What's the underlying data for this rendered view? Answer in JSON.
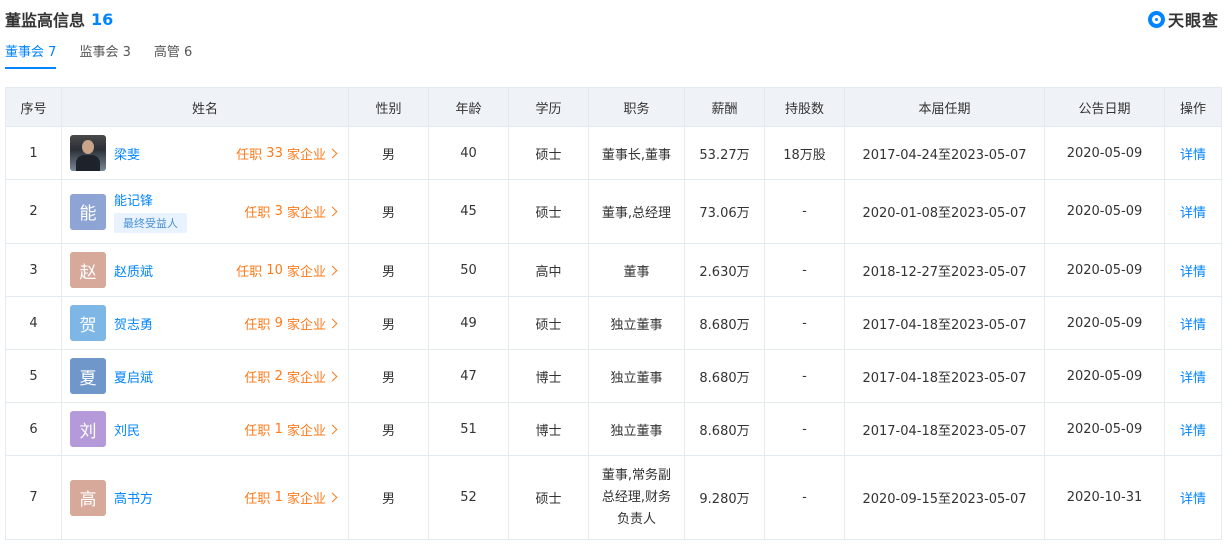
{
  "header": {
    "title": "董监高信息",
    "count": "16",
    "logo_text": "天眼查"
  },
  "tabs": [
    {
      "label": "董事会",
      "count": "7"
    },
    {
      "label": "监事会",
      "count": "3"
    },
    {
      "label": "高管",
      "count": "6"
    }
  ],
  "table": {
    "columns": [
      "序号",
      "姓名",
      "性别",
      "年龄",
      "学历",
      "职务",
      "薪酬",
      "持股数",
      "本届任期",
      "公告日期",
      "操作"
    ],
    "rows": [
      {
        "no": "1",
        "avatar": "",
        "name": "梁斐",
        "job_prefix": "任职",
        "job_count": "33",
        "job_suffix": "家企业",
        "badge": "",
        "gender": "男",
        "age": "40",
        "edu": "硕士",
        "title": "董事长,董事",
        "salary": "53.27万",
        "shares": "18万股",
        "term": "2017-04-24至2023-05-07",
        "date": "2020-05-09",
        "action": "详情",
        "color": ""
      },
      {
        "no": "2",
        "avatar": "能",
        "name": "能记锋",
        "job_prefix": "任职",
        "job_count": "3",
        "job_suffix": "家企业",
        "badge": "最终受益人",
        "gender": "男",
        "age": "45",
        "edu": "硕士",
        "title": "董事,总经理",
        "salary": "73.06万",
        "shares": "-",
        "term": "2020-01-08至2023-05-07",
        "date": "2020-05-09",
        "action": "详情",
        "color": "#8da4d4"
      },
      {
        "no": "3",
        "avatar": "赵",
        "name": "赵质斌",
        "job_prefix": "任职",
        "job_count": "10",
        "job_suffix": "家企业",
        "badge": "",
        "gender": "男",
        "age": "50",
        "edu": "高中",
        "title": "董事",
        "salary": "2.630万",
        "shares": "-",
        "term": "2018-12-27至2023-05-07",
        "date": "2020-05-09",
        "action": "详情",
        "color": "#d6a99b"
      },
      {
        "no": "4",
        "avatar": "贺",
        "name": "贺志勇",
        "job_prefix": "任职",
        "job_count": "9",
        "job_suffix": "家企业",
        "badge": "",
        "gender": "男",
        "age": "49",
        "edu": "硕士",
        "title": "独立董事",
        "salary": "8.680万",
        "shares": "-",
        "term": "2017-04-18至2023-05-07",
        "date": "2020-05-09",
        "action": "详情",
        "color": "#7eb6e6"
      },
      {
        "no": "5",
        "avatar": "夏",
        "name": "夏启斌",
        "job_prefix": "任职",
        "job_count": "2",
        "job_suffix": "家企业",
        "badge": "",
        "gender": "男",
        "age": "47",
        "edu": "博士",
        "title": "独立董事",
        "salary": "8.680万",
        "shares": "-",
        "term": "2017-04-18至2023-05-07",
        "date": "2020-05-09",
        "action": "详情",
        "color": "#6f97c9"
      },
      {
        "no": "6",
        "avatar": "刘",
        "name": "刘民",
        "job_prefix": "任职",
        "job_count": "1",
        "job_suffix": "家企业",
        "badge": "",
        "gender": "男",
        "age": "51",
        "edu": "博士",
        "title": "独立董事",
        "salary": "8.680万",
        "shares": "-",
        "term": "2017-04-18至2023-05-07",
        "date": "2020-05-09",
        "action": "详情",
        "color": "#b49ad9"
      },
      {
        "no": "7",
        "avatar": "高",
        "name": "高书方",
        "job_prefix": "任职",
        "job_count": "1",
        "job_suffix": "家企业",
        "badge": "",
        "gender": "男",
        "age": "52",
        "edu": "硕士",
        "title": "董事,常务副总经理,财务负责人",
        "title_lines": [
          "董事,常务副",
          "总经理,财务",
          "负责人"
        ],
        "salary": "9.280万",
        "shares": "-",
        "term": "2020-09-15至2023-05-07",
        "date": "2020-10-31",
        "action": "详情",
        "color": "#d6a99b"
      }
    ]
  }
}
